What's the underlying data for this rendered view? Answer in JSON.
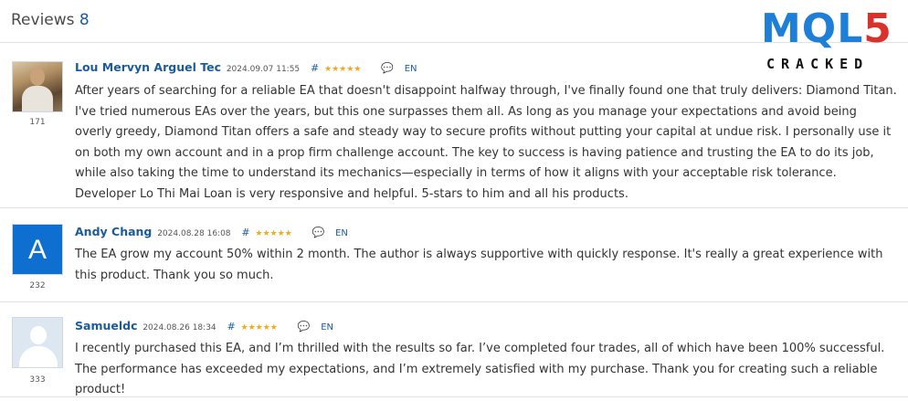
{
  "header": {
    "title": "Reviews",
    "count": "8"
  },
  "logo": {
    "mql": "MQL",
    "five": "5",
    "cracked": "CRACKED"
  },
  "reviews": [
    {
      "avatar_type": "photo",
      "rank": "171",
      "name": "Lou Mervyn Arguel Tec",
      "date": "2024.09.07 11:55",
      "hash": "#",
      "stars": "★★★★★",
      "rating": 5,
      "bubble": "💬",
      "lang": "EN",
      "text": "After years of searching for a reliable EA that doesn't disappoint halfway through, I've finally found one that truly delivers: Diamond Titan. I've tried numerous EAs over the years, but this one surpasses them all. As long as you manage your expectations and avoid being overly greedy, Diamond Titan offers a safe and steady way to secure profits without putting your capital at undue risk. I personally use it on both my own account and in a prop firm challenge account. The key to success is having patience and trusting the EA to do its job, while also taking the time to understand its mechanics—especially in terms of how it aligns with your acceptable risk tolerance. Developer Lo Thi Mai Loan is very responsive and helpful. 5-stars to him and all his products."
    },
    {
      "avatar_type": "letter",
      "avatar_letter": "A",
      "rank": "232",
      "name": "Andy Chang",
      "date": "2024.08.28 16:08",
      "hash": "#",
      "stars": "★★★★★",
      "rating": 5,
      "bubble": "💬",
      "lang": "EN",
      "text": "The EA grow my account 50% within 2 month. The author is always supportive with quickly response. It's really a great experience with this product. Thank you so much."
    },
    {
      "avatar_type": "silhouette",
      "rank": "333",
      "name": "Samueldc",
      "date": "2024.08.26 18:34",
      "hash": "#",
      "stars": "★★★★★",
      "rating": 5,
      "bubble": "💬",
      "lang": "EN",
      "text": "I recently purchased this EA, and I’m thrilled with the results so far. I’ve completed four trades, all of which have been 100% successful. The performance has exceeded my expectations, and I’m extremely satisfied with my purchase. Thank you for creating such a reliable product!"
    }
  ]
}
